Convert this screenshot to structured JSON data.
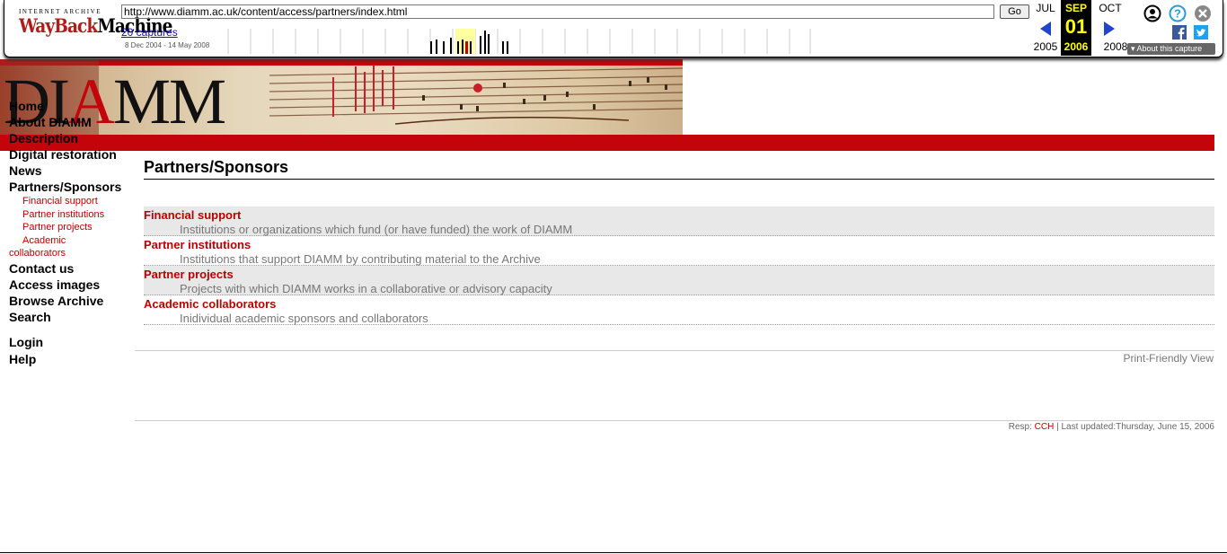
{
  "wayback": {
    "logo_top": "INTERNET ARCHIVE",
    "logo_main_1": "WayBack",
    "logo_main_2": "Machine",
    "url": "http://www.diamm.ac.uk/content/access/partners/index.html",
    "go_label": "Go",
    "captures_label": "20 captures",
    "date_range": "8 Dec 2004 - 14 May 2008",
    "prev_month": "JUL",
    "cur_month": "SEP",
    "next_month": "OCT",
    "cur_day": "01",
    "prev_year": "2005",
    "cur_year": "2006",
    "next_year": "2008",
    "about_label": "About this capture",
    "accent": "#ffff00",
    "nav_arrow_color": "#2244cc"
  },
  "site": {
    "logo_text_1": "DI",
    "logo_text_A": "A",
    "logo_text_2": "MM",
    "brand_red": "#c4040b"
  },
  "nav": {
    "home": "Home",
    "about": "About DIAMM",
    "description": "Description",
    "digital_restoration": "Digital restoration",
    "news": "News",
    "partners": "Partners/Sponsors",
    "sub_financial": "Financial support",
    "sub_institutions": "Partner institutions",
    "sub_projects": "Partner projects",
    "sub_academic": "Academic collaborators",
    "contact": "Contact us",
    "access_images": "Access images",
    "browse_archive": "Browse Archive",
    "search": "Search",
    "login": "Login",
    "help": "Help"
  },
  "main": {
    "title": "Partners/Sponsors",
    "items": [
      {
        "title": "Financial support",
        "desc": "Institutions or organizations which fund (or have funded) the work of DIAMM"
      },
      {
        "title": "Partner institutions",
        "desc": "Institutions that support DIAMM by contributing material to the Archive"
      },
      {
        "title": "Partner projects",
        "desc": "Projects with which DIAMM works in a collaborative or advisory capacity"
      },
      {
        "title": "Academic collaborators",
        "desc": "Inidividual academic sponsors and collaborators"
      }
    ],
    "print_label": "Print-Friendly View"
  },
  "footer": {
    "resp_label": "Resp:",
    "resp_name": "CCH",
    "separator": "|",
    "updated": "Last updated:Thursday, June 15, 2006"
  }
}
